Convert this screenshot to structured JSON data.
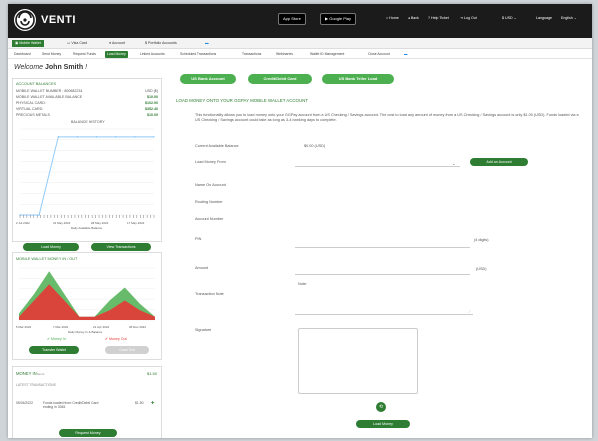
{
  "app": {
    "brand": "VENTI"
  },
  "stores": {
    "app_store": "App Store",
    "google_play": "Google Play"
  },
  "top_links": [
    {
      "label": "Home"
    },
    {
      "label": "Back"
    },
    {
      "label": "Help Ticket"
    },
    {
      "label": "Log Out"
    },
    {
      "label": "USD"
    },
    {
      "label": "Language"
    },
    {
      "label": "English"
    }
  ],
  "nav_tabs": [
    {
      "label": "Mobile Wallet"
    },
    {
      "label": "Visa Card"
    },
    {
      "label": "Account"
    },
    {
      "label": "Portfolio Accounts"
    }
  ],
  "sub_tabs": [
    {
      "label": "Dashboard"
    },
    {
      "label": "Send Money"
    },
    {
      "label": "Request Funds"
    },
    {
      "label": "Load Money"
    },
    {
      "label": "Linked Accounts"
    },
    {
      "label": "Scheduled Transactions"
    },
    {
      "label": "Transactions"
    },
    {
      "label": "Webinaries"
    },
    {
      "label": "Wallet ID Management"
    },
    {
      "label": "Close Account"
    }
  ],
  "left": {
    "welcome_prefix": "Welcome",
    "user_name": "John Smith",
    "welcome_suffix": "!",
    "balances_title": "Account Balances",
    "balances": [
      {
        "label": "Mobile Wallet Number : 800682234",
        "value": "USD ($)"
      },
      {
        "label": "Mobile Wallet Available Balance",
        "value": "$10.00"
      },
      {
        "label": "Physical Card:",
        "value": "$102.00"
      },
      {
        "label": "Virtual Card:",
        "value": "$352.40"
      },
      {
        "label": "Precious Metals",
        "value": "$10.00"
      }
    ],
    "balance_history_title": "Balance History",
    "balance_chart_xlabels": [
      "2 Jul 2022",
      "31 May 2022",
      "28 May 2022",
      "17 May 2022"
    ],
    "balance_chart_caption": "Daily Available Balance",
    "load_money_btn": "Load Money",
    "view_transactions_btn": "View Transactions",
    "inout_title": "Mobile Wallet Money In / Out",
    "inout_xlabels": [
      "5 Mar 2022",
      "7 Mar 2022",
      "21 Apr 2022",
      "06 Dec 2022"
    ],
    "inout_caption": "Daily Money In & Balance",
    "legend_in": "Money In",
    "legend_out": "Money Out",
    "transfer_btn": "Transfer Wallet",
    "cash_out_btn": "Cash Out",
    "money_in_title": "Money In",
    "money_in_badge": "Items",
    "money_in_value": "$1.50",
    "latest_tx_title": "Latest Transactions",
    "tx_date": "05/04/2022",
    "tx_desc": "Funds loaded from Credit/Debit Card ending in 3345",
    "tx_amount": "$1.50",
    "request_money_btn": "Request Money"
  },
  "main": {
    "pills": [
      {
        "label": "US Bank Account"
      },
      {
        "label": "Credit/Debit Card"
      },
      {
        "label": "US Bank Teller Load"
      }
    ],
    "title": "Load Money Onto Your GGPay Mobile Wallet Account",
    "description": "This functionality allows you to load money onto your GGPay account from a US Checking / Savings account. The cost to load any amount of money from a US Checking / Savings account is only $1.00 (USD). Funds loaded via a US Checking / Savings account could take as long as 3-4 banking days to complete.",
    "fields": {
      "current_balance_label": "Current Available Balance",
      "current_balance_value": "$0.00 (USD)",
      "load_from_label": "Load Money From",
      "add_account_btn": "Add an Account",
      "name_label": "Name On Account",
      "routing_label": "Routing Number",
      "account_label": "Account Number",
      "pin_label": "PIN",
      "pin_hint": "(4 digits)",
      "amount_label": "Amount",
      "amount_unit": "(USD)",
      "note_placeholder": "Note:",
      "tx_note_label": "Transaction Note",
      "signature_label": "Signature",
      "submit_btn": "Load Money"
    }
  },
  "colors": {
    "accent": "#2e7d32",
    "light_accent": "#4caf50",
    "money_in": "#4caf50",
    "money_out": "#e53935"
  },
  "chart_data": [
    {
      "type": "line",
      "title": "Balance History",
      "xlabel": "Daily Available Balance",
      "categories": [
        "2 Jul 2022",
        "31 May 2022",
        "28 May 2022",
        "17 May 2022"
      ],
      "series": [
        {
          "values": [
            0,
            0,
            100,
            100,
            100,
            100,
            100,
            100
          ]
        }
      ],
      "grid": true
    },
    {
      "type": "area",
      "title": "Mobile Wallet Money In / Out",
      "xlabel": "Daily Money In & Balance",
      "categories": [
        "5 Mar 2022",
        "7 Mar 2022",
        "21 Apr 2022",
        "06 Dec 2022"
      ],
      "series": [
        {
          "name": "Money In",
          "values": [
            10,
            40,
            75,
            40,
            5,
            5,
            30,
            50,
            25,
            5
          ]
        },
        {
          "name": "Money Out",
          "values": [
            5,
            30,
            55,
            30,
            5,
            5,
            15,
            30,
            15,
            5
          ]
        }
      ],
      "legend": "bottom",
      "grid": true
    }
  ]
}
